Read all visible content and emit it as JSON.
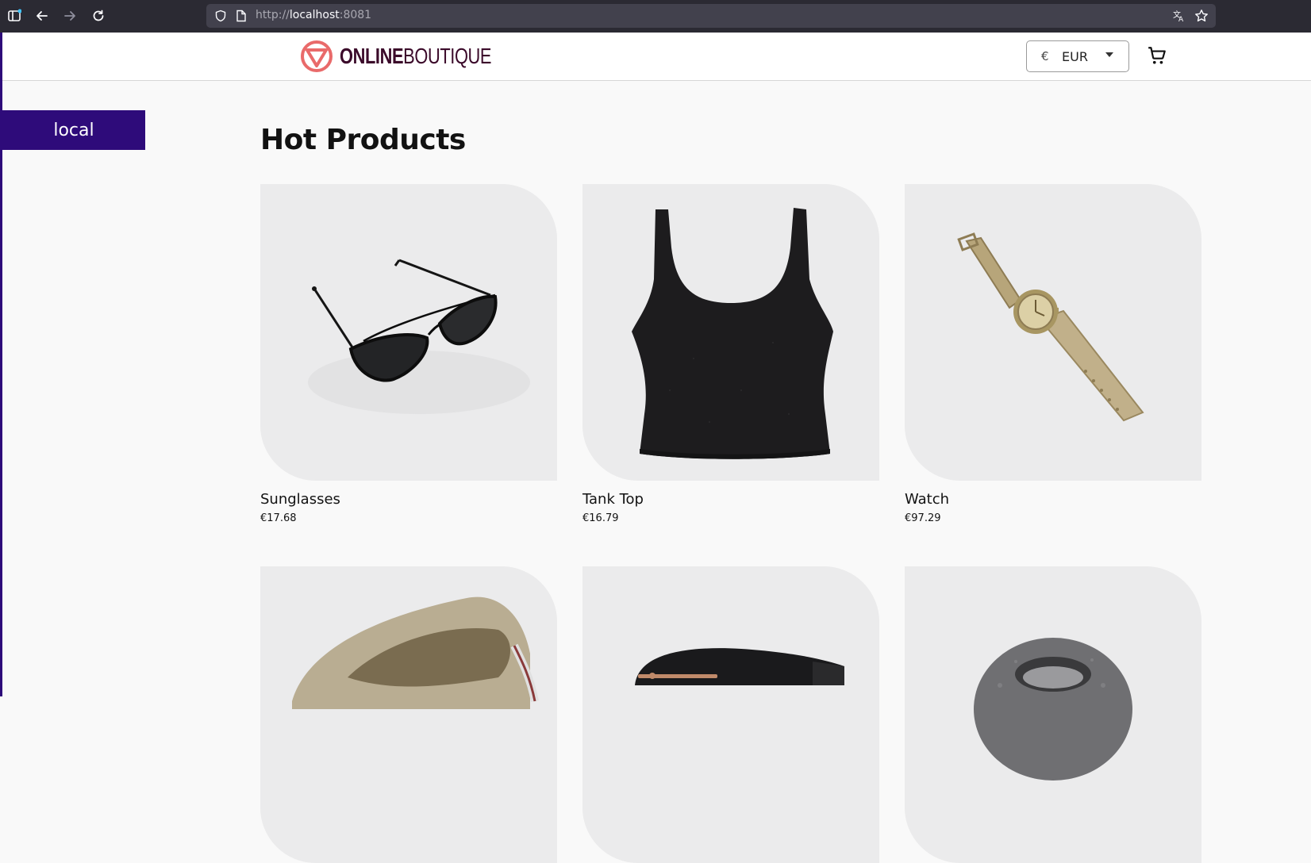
{
  "browser": {
    "url_scheme": "http://",
    "url_host": "localhost",
    "url_port": ":8081"
  },
  "header": {
    "logo_bold": "ONLINE",
    "logo_thin": "BOUTIQUE",
    "currency_symbol": "€",
    "currency_code": "EUR"
  },
  "env_badge": "local",
  "section_title": "Hot Products",
  "products": [
    {
      "name": "Sunglasses",
      "price": "€17.68"
    },
    {
      "name": "Tank Top",
      "price": "€16.79"
    },
    {
      "name": "Watch",
      "price": "€97.29"
    },
    {
      "name": "",
      "price": ""
    },
    {
      "name": "",
      "price": ""
    },
    {
      "name": "",
      "price": ""
    }
  ],
  "colors": {
    "brand": "#3b0a2a",
    "badge": "#2e0b7a",
    "logo_mark": "#e96a6a"
  }
}
